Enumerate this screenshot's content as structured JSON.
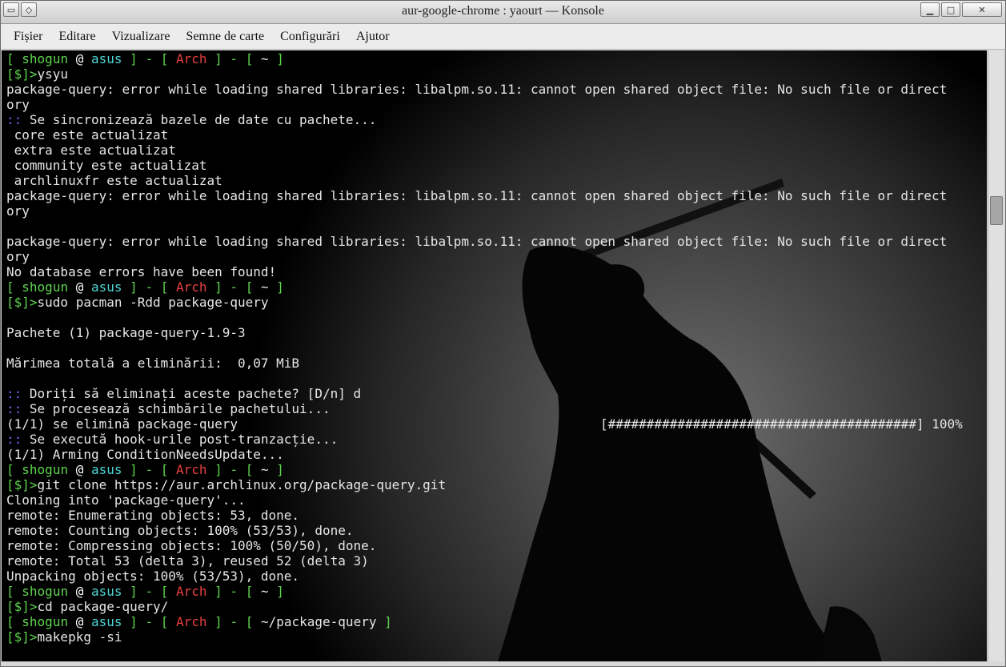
{
  "window": {
    "title": "aur-google-chrome : yaourt — Konsole"
  },
  "menu": [
    "Fișier",
    "Editare",
    "Vizualizare",
    "Semne de carte",
    "Configurări",
    "Ajutor"
  ],
  "prompt": {
    "open": "[",
    "user": "shogun",
    "at": "@",
    "host": "asus",
    "close_dash": "] - [",
    "distro": "Arch",
    "close": "]",
    "home_dir": "~",
    "repo_dir": "~/package-query",
    "ps1": "[$]>"
  },
  "commands": {
    "c1": "ysyu",
    "c2": "sudo pacman -Rdd package-query",
    "c3": "git clone https://aur.archlinux.org/package-query.git",
    "c4": "cd package-query/",
    "c5": "makepkg -si"
  },
  "output": {
    "err_a": "package-query: error while loading shared libraries: libalpm.so.11: cannot open shared object file: No such file or direct",
    "err_b": "ory",
    "sync_marker": "::",
    "sync": " Se sincronizează bazele de date cu pachete...",
    "core": " core este actualizat",
    "extra": " extra este actualizat",
    "community": " community este actualizat",
    "archlinuxfr": " archlinuxfr este actualizat",
    "no_db_errors": "No database errors have been found!",
    "packages": "Pachete (1) package-query-1.9-3",
    "total_size": "Mărimea totală a eliminării:  0,07 MiB",
    "confirm": " Doriți să eliminați aceste pachete? [D/n] d",
    "processing": " Se procesează schimbările pachetului...",
    "removing": "(1/1) se elimină package-query",
    "progress_bar": "[########################################] 100%",
    "hooks": " Se execută hook-urile post-tranzacție...",
    "arming": "(1/1) Arming ConditionNeedsUpdate...",
    "cloning": "Cloning into 'package-query'...",
    "enumerating": "remote: Enumerating objects: 53, done.",
    "counting": "remote: Counting objects: 100% (53/53), done.",
    "compressing": "remote: Compressing objects: 100% (50/50), done.",
    "total": "remote: Total 53 (delta 3), reused 52 (delta 3)",
    "unpacking": "Unpacking objects: 100% (53/53), done."
  }
}
